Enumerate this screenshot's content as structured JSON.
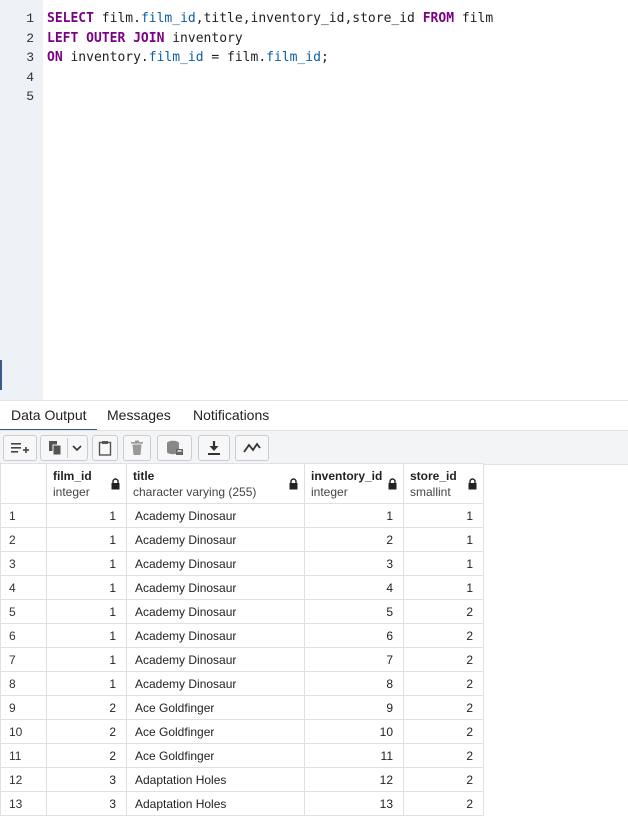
{
  "editor": {
    "line_numbers": [
      "1",
      "2",
      "3",
      "4",
      "5"
    ],
    "lines": [
      [
        {
          "t": "SELECT",
          "k": "kw"
        },
        {
          "t": " film.",
          "k": ""
        },
        {
          "t": "film_id",
          "k": "col"
        },
        {
          "t": ",title,inventory_id,store_id ",
          "k": ""
        },
        {
          "t": "FROM",
          "k": "kw"
        },
        {
          "t": " film",
          "k": ""
        }
      ],
      [
        {
          "t": "LEFT OUTER JOIN",
          "k": "kw"
        },
        {
          "t": " inventory",
          "k": ""
        }
      ],
      [
        {
          "t": "ON",
          "k": "kw"
        },
        {
          "t": " inventory.",
          "k": ""
        },
        {
          "t": "film_id",
          "k": "col"
        },
        {
          "t": " = film.",
          "k": ""
        },
        {
          "t": "film_id",
          "k": "col"
        },
        {
          "t": ";",
          "k": ""
        }
      ]
    ]
  },
  "tabs": [
    {
      "label": "Data Output",
      "active": true
    },
    {
      "label": "Messages",
      "active": false
    },
    {
      "label": "Notifications",
      "active": false
    }
  ],
  "toolbar": {
    "icons": [
      "add-row-icon",
      "copy-icon",
      "dropdown-icon",
      "paste-icon",
      "delete-icon",
      "save-data-icon",
      "download-icon",
      "graph-icon"
    ]
  },
  "grid": {
    "columns": [
      {
        "name": "film_id",
        "type": "integer"
      },
      {
        "name": "title",
        "type": "character varying (255)"
      },
      {
        "name": "inventory_id",
        "type": "integer"
      },
      {
        "name": "store_id",
        "type": "smallint"
      }
    ],
    "rows": [
      [
        "1",
        "1",
        "Academy Dinosaur",
        "1",
        "1"
      ],
      [
        "2",
        "1",
        "Academy Dinosaur",
        "2",
        "1"
      ],
      [
        "3",
        "1",
        "Academy Dinosaur",
        "3",
        "1"
      ],
      [
        "4",
        "1",
        "Academy Dinosaur",
        "4",
        "1"
      ],
      [
        "5",
        "1",
        "Academy Dinosaur",
        "5",
        "2"
      ],
      [
        "6",
        "1",
        "Academy Dinosaur",
        "6",
        "2"
      ],
      [
        "7",
        "1",
        "Academy Dinosaur",
        "7",
        "2"
      ],
      [
        "8",
        "1",
        "Academy Dinosaur",
        "8",
        "2"
      ],
      [
        "9",
        "2",
        "Ace Goldfinger",
        "9",
        "2"
      ],
      [
        "10",
        "2",
        "Ace Goldfinger",
        "10",
        "2"
      ],
      [
        "11",
        "2",
        "Ace Goldfinger",
        "11",
        "2"
      ],
      [
        "12",
        "3",
        "Adaptation Holes",
        "12",
        "2"
      ],
      [
        "13",
        "3",
        "Adaptation Holes",
        "13",
        "2"
      ]
    ]
  }
}
